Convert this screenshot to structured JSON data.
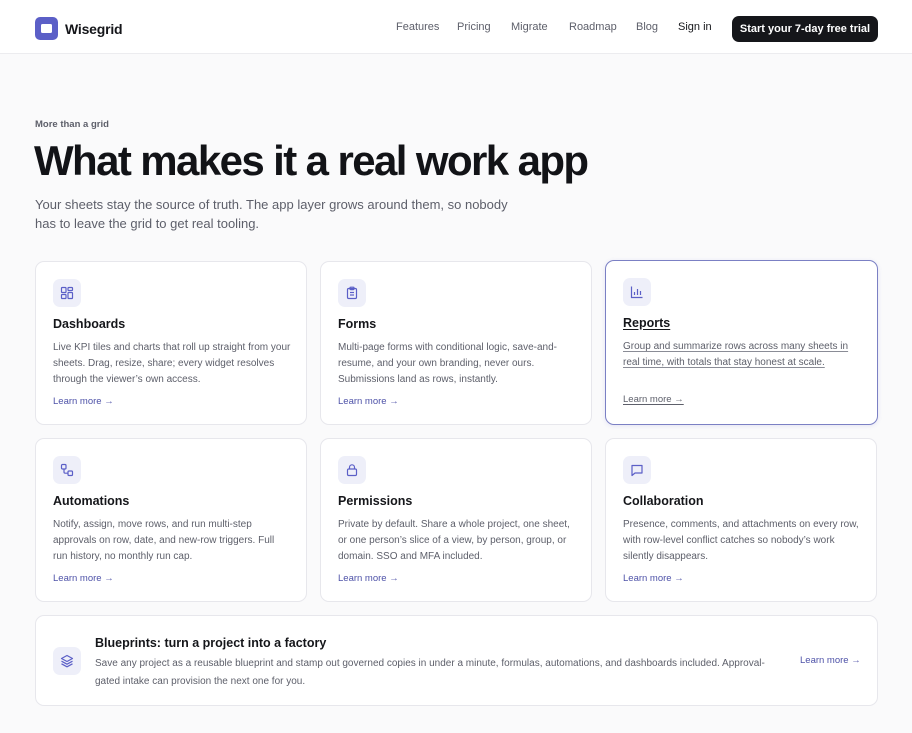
{
  "brand": {
    "name": "Wisegrid",
    "accent": "#5b5fc7"
  },
  "nav": {
    "features": "Features",
    "pricing": "Pricing",
    "migrate": "Migrate",
    "roadmap": "Roadmap",
    "blog": "Blog",
    "signin": "Sign in",
    "cta": "Start your 7-day free trial"
  },
  "hero": {
    "eyebrow": "More than a grid",
    "title": "What makes it a real work app",
    "lede": "Your sheets stay the source of truth. The app layer grows around them, so nobody has to leave the grid to get real tooling."
  },
  "features": [
    {
      "icon": "grid-icon",
      "title": "Dashboards",
      "desc": "Live KPI tiles and charts that roll up straight from your sheets. Drag, resize, share; every widget resolves through the viewer’s own access.",
      "link": "Learn more →"
    },
    {
      "icon": "clipboard-icon",
      "title": "Forms",
      "desc": "Multi-page forms with conditional logic, save-and-resume, and your own branding, never ours. Submissions land as rows, instantly.",
      "link": "Learn more →"
    },
    {
      "icon": "bar-chart-icon",
      "title": "Reports",
      "desc": "Group and summarize rows across many sheets in real time, with totals that stay honest at scale.",
      "link": "Learn more →"
    },
    {
      "icon": "workflow-icon",
      "title": "Automations",
      "desc": "Notify, assign, move rows, and run multi-step approvals on row, date, and new-row triggers. Full run history, no monthly run cap.",
      "link": "Learn more →"
    },
    {
      "icon": "lock-icon",
      "title": "Permissions",
      "desc": "Private by default. Share a whole project, one sheet, or one person’s slice of a view, by person, group, or domain. SSO and MFA included.",
      "link": "Learn more →"
    },
    {
      "icon": "chat-icon",
      "title": "Collaboration",
      "desc": "Presence, comments, and attachments on every row, with row-level conflict catches so nobody’s work silently disappears.",
      "link": "Learn more →"
    }
  ],
  "blueprint": {
    "icon": "layers-icon",
    "title": "Blueprints: turn a project into a factory",
    "desc": "Save any project as a reusable blueprint and stamp out governed copies in under a minute, formulas, automations, and dashboards included. Approval-gated intake can provision the next one for you.",
    "link": "Learn more →"
  }
}
